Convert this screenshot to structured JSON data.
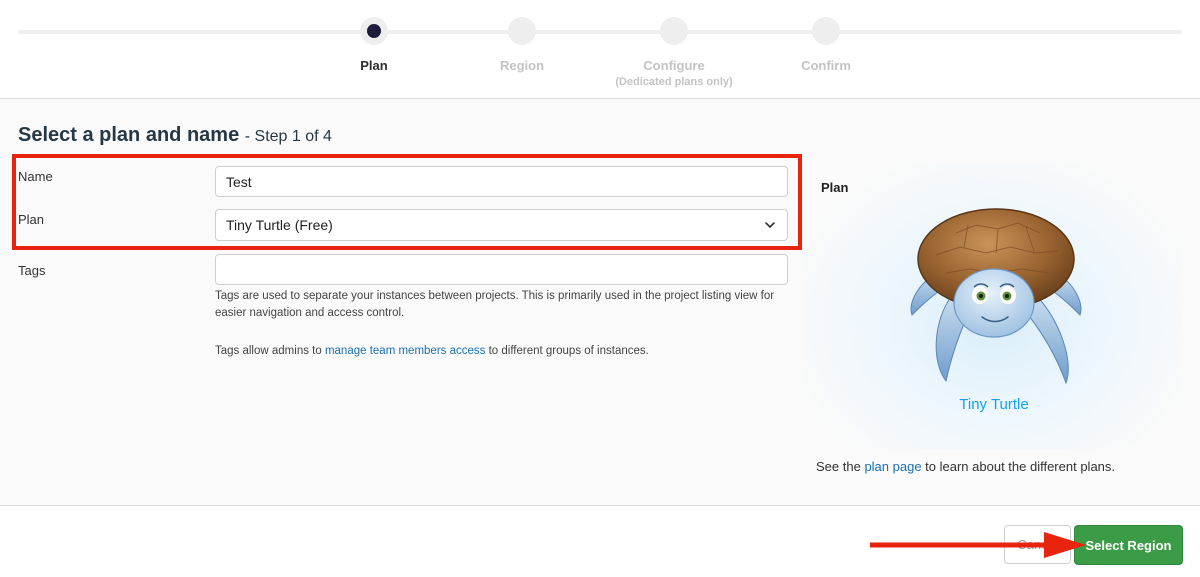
{
  "stepper": {
    "steps": [
      {
        "label": "Plan",
        "sub": "",
        "state": "active"
      },
      {
        "label": "Region",
        "sub": "",
        "state": "inactive"
      },
      {
        "label": "Configure",
        "sub": "(Dedicated plans only)",
        "state": "inactive"
      },
      {
        "label": "Confirm",
        "sub": "",
        "state": "inactive"
      }
    ]
  },
  "page": {
    "title": "Select a plan and name",
    "step_suffix": "- Step 1 of 4"
  },
  "form": {
    "name_label": "Name",
    "name_value": "Test",
    "plan_label": "Plan",
    "plan_value": "Tiny Turtle (Free)",
    "tags_label": "Tags",
    "tags_value": "",
    "tags_help_1": "Tags are used to separate your instances between projects. This is primarily used in the project listing view for easier navigation and access control.",
    "tags_help_2_prefix": "Tags allow admins to ",
    "tags_help_2_link": "manage team members access",
    "tags_help_2_suffix": " to different groups of instances."
  },
  "plan_card": {
    "title": "Plan",
    "plan_name": "Tiny Turtle",
    "foot_prefix": "See the ",
    "foot_link": "plan page",
    "foot_suffix": " to learn about the different plans."
  },
  "footer": {
    "cancel_label": "Cancel",
    "primary_label": "Select Region"
  },
  "colors": {
    "primary_button": "#3c9b46",
    "highlight": "#e8230e",
    "link": "#1a6fb0",
    "plan_name": "#17a1e8"
  },
  "icons": {
    "plan_select": "chevron-down-icon",
    "annotation": "arrow-right-icon"
  }
}
